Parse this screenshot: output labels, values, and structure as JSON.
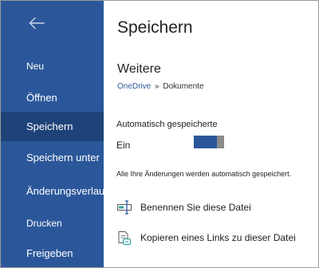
{
  "sidebar": {
    "items": [
      {
        "label": "Neu"
      },
      {
        "label": "Öffnen"
      },
      {
        "label": "Speichern"
      },
      {
        "label": "Speichern unter"
      },
      {
        "label": "Änderungsverlauf"
      },
      {
        "label": "Drucken"
      },
      {
        "label": "Freigeben"
      }
    ],
    "active": "Speichern"
  },
  "main": {
    "title": "Speichern",
    "section_title": "Weitere",
    "breadcrumb": {
      "location": "OneDrive",
      "separator": "»",
      "folder": "Dokumente"
    },
    "autosave": {
      "label": "Automatisch gespeicherte",
      "state_text": "Ein",
      "enabled": true
    },
    "info_text": "Alle Ihre Änderungen werden automatisch gespeichert.",
    "actions": [
      {
        "label": "Benennen Sie diese Datei",
        "icon": "rename-icon"
      },
      {
        "label": "Kopieren eines Links zu dieser Datei",
        "icon": "copy-link-icon"
      }
    ]
  },
  "colors": {
    "sidebar_bg": "#2b579a",
    "sidebar_active_bg": "#1e4379",
    "accent": "#2b579a",
    "toggle_thumb": "#8a8a8a"
  }
}
